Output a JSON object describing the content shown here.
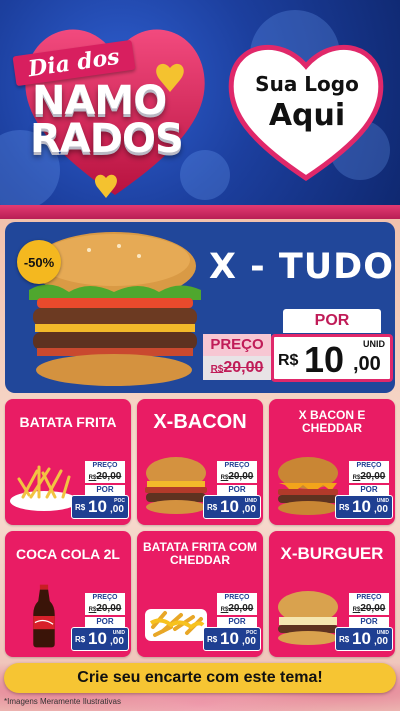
{
  "header": {
    "ribbon": "Dia dos",
    "title_line1": "NAMO",
    "title_line2": "RADOS",
    "logo_line1": "Sua Logo",
    "logo_line2": "Aqui"
  },
  "featured": {
    "discount": "-50%",
    "name": "X - TUDO",
    "preco_label": "PREÇO",
    "old_currency": "R$",
    "old_price": "20,00",
    "por_label": "POR",
    "currency": "R$",
    "price_int": "10",
    "price_dec": ",00",
    "unit": "UNID"
  },
  "items": [
    {
      "name": "BATATA FRITA",
      "preco_label": "PREÇO",
      "old_currency": "R$",
      "old_price": "20,00",
      "por_label": "POR",
      "currency": "R$",
      "price_int": "10",
      "price_dec": ",00",
      "unit": "POC",
      "food": "fries-icon"
    },
    {
      "name": "X-BACON",
      "preco_label": "PREÇO",
      "old_currency": "R$",
      "old_price": "20,00",
      "por_label": "POR",
      "currency": "R$",
      "price_int": "10",
      "price_dec": ",00",
      "unit": "UNID",
      "food": "bacon-burger-icon"
    },
    {
      "name": "X BACON E CHEDDAR",
      "preco_label": "PREÇO",
      "old_currency": "R$",
      "old_price": "20,00",
      "por_label": "POR",
      "currency": "R$",
      "price_int": "10",
      "price_dec": ",00",
      "unit": "UNID",
      "food": "cheddar-burger-icon"
    },
    {
      "name": "COCA COLA 2L",
      "preco_label": "PREÇO",
      "old_currency": "R$",
      "old_price": "20,00",
      "por_label": "POR",
      "currency": "R$",
      "price_int": "10",
      "price_dec": ",00",
      "unit": "UNID",
      "food": "soda-bottle-icon"
    },
    {
      "name": "BATATA FRITA COM CHEDDAR",
      "preco_label": "PREÇO",
      "old_currency": "R$",
      "old_price": "20,00",
      "por_label": "POR",
      "currency": "R$",
      "price_int": "10",
      "price_dec": ",00",
      "unit": "POC",
      "food": "cheddar-fries-icon"
    },
    {
      "name": "X-BURGUER",
      "preco_label": "PREÇO",
      "old_currency": "R$",
      "old_price": "20,00",
      "por_label": "POR",
      "currency": "R$",
      "price_int": "10",
      "price_dec": ",00",
      "unit": "UNID",
      "food": "burger-icon"
    }
  ],
  "cta": "Crie seu encarte com este tema!",
  "disclaimer": "*Imagens Meramente Ilustrativas",
  "colors": {
    "primary_blue": "#21479a",
    "accent_pink": "#e91c64",
    "accent_yellow": "#f6c533"
  }
}
